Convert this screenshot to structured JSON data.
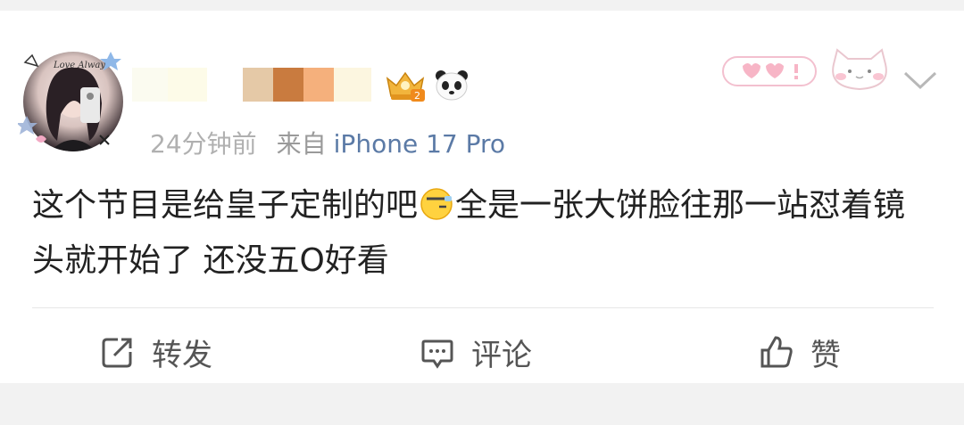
{
  "post": {
    "time": "24分钟前",
    "from_label": "来自",
    "device": "iPhone 17 Pro",
    "avatar_caption": "Love Always",
    "content_part1": "这个节目是给皇子定制的吧",
    "content_part2": "全是一张大饼脸往那一站怼着镜头就开始了 还没五O好看"
  },
  "actions": {
    "repost_label": "转发",
    "comment_label": "评论",
    "like_label": "赞"
  },
  "icons": {
    "avatar": "avatar-image",
    "vip": "crown-badge-icon",
    "panda": "panda-icon",
    "bubble_sticker": "heart-bubble-sticker",
    "cat_sticker": "cat-sticker",
    "more": "chevron-down-icon",
    "repost": "share-icon",
    "comment": "comment-icon",
    "like": "thumbs-up-icon",
    "inline_emoji": "speechless-face-emoji"
  },
  "colors": {
    "device_link": "#5b7aa6",
    "time_text": "#b0b0b0",
    "badge_gold": "#f2b53c",
    "sticker_pink": "#f7b5c6"
  }
}
